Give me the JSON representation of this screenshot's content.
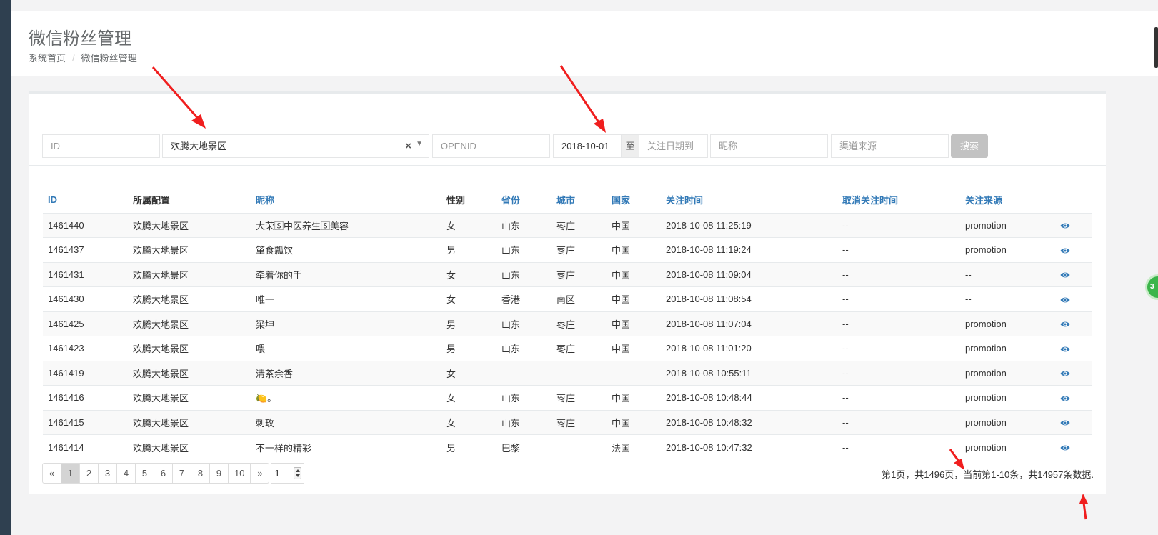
{
  "page": {
    "title": "微信粉丝管理",
    "breadcrumb": [
      "系统首页",
      "微信粉丝管理"
    ]
  },
  "search": {
    "id_placeholder": "ID",
    "config_value": "欢腾大地景区",
    "openid_placeholder": "OPENID",
    "date_from_value": "2018-10-01",
    "date_separator": "至",
    "date_to_placeholder": "关注日期到",
    "nickname_placeholder": "昵称",
    "channel_placeholder": "渠道来源",
    "search_button": "搜索"
  },
  "table": {
    "headers": [
      "ID",
      "所属配置",
      "昵称",
      "性别",
      "省份",
      "城市",
      "国家",
      "关注时间",
      "取消关注时间",
      "关注来源",
      ""
    ],
    "rows": [
      [
        "1461440",
        "欢腾大地景区",
        "大荣🅂中医养生🅂美容",
        "女",
        "山东",
        "枣庄",
        "中国",
        "2018-10-08 11:25:19",
        "--",
        "promotion"
      ],
      [
        "1461437",
        "欢腾大地景区",
        "箪食瓢饮",
        "男",
        "山东",
        "枣庄",
        "中国",
        "2018-10-08 11:19:24",
        "--",
        "promotion"
      ],
      [
        "1461431",
        "欢腾大地景区",
        "牵着你的手",
        "女",
        "山东",
        "枣庄",
        "中国",
        "2018-10-08 11:09:04",
        "--",
        "--"
      ],
      [
        "1461430",
        "欢腾大地景区",
        "唯一",
        "女",
        "香港",
        "南区",
        "中国",
        "2018-10-08 11:08:54",
        "--",
        "--"
      ],
      [
        "1461425",
        "欢腾大地景区",
        "梁坤",
        "男",
        "山东",
        "枣庄",
        "中国",
        "2018-10-08 11:07:04",
        "--",
        "promotion"
      ],
      [
        "1461423",
        "欢腾大地景区",
        "喂",
        "男",
        "山东",
        "枣庄",
        "中国",
        "2018-10-08 11:01:20",
        "--",
        "promotion"
      ],
      [
        "1461419",
        "欢腾大地景区",
        "清茶余香",
        "女",
        "",
        "",
        "",
        "2018-10-08 10:55:11",
        "--",
        "promotion"
      ],
      [
        "1461416",
        "欢腾大地景区",
        "🍋。",
        "女",
        "山东",
        "枣庄",
        "中国",
        "2018-10-08 10:48:44",
        "--",
        "promotion"
      ],
      [
        "1461415",
        "欢腾大地景区",
        "刺玫",
        "女",
        "山东",
        "枣庄",
        "中国",
        "2018-10-08 10:48:32",
        "--",
        "promotion"
      ],
      [
        "1461414",
        "欢腾大地景区",
        "不一样的精彩",
        "男",
        "巴黎",
        "",
        "法国",
        "2018-10-08 10:47:32",
        "--",
        "promotion"
      ]
    ]
  },
  "pagination": {
    "prev": "«",
    "pages": [
      "1",
      "2",
      "3",
      "4",
      "5",
      "6",
      "7",
      "8",
      "9",
      "10"
    ],
    "next": "»",
    "jump_value": "1",
    "info": "第1页，共1496页，当前第1-10条，共14957条数据."
  },
  "badge_text": "3",
  "colors": {
    "sidebar": "#2f4050",
    "link": "#337ab7",
    "arrow": "#f01e1e",
    "badge": "#3bb54a"
  }
}
